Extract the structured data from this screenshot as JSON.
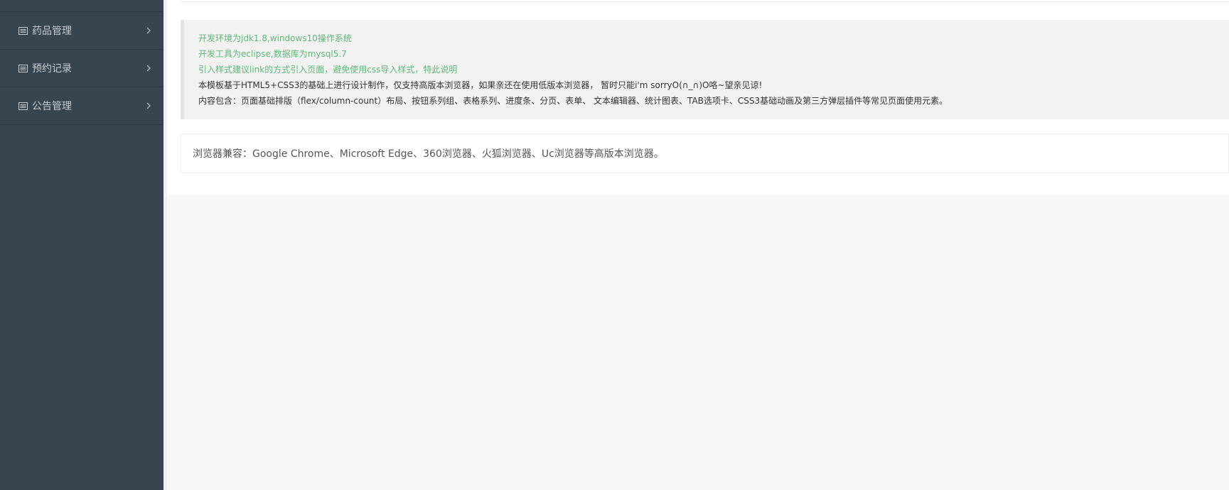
{
  "sidebar": {
    "items": [
      {
        "label": "药品管理",
        "icon": "list-icon"
      },
      {
        "label": "预约记录",
        "icon": "list-icon"
      },
      {
        "label": "公告管理",
        "icon": "list-icon"
      }
    ]
  },
  "notice": {
    "lines": [
      "开发环境为jdk1.8,windows10操作系统",
      "开发工具为eclipse,数据库为mysql5.7",
      "引入样式建议link的方式引入页面，避免使用css导入样式，特此说明",
      "本模板基于HTML5+CSS3的基础上进行设计制作，仅支持高版本浏览器，如果亲还在使用低版本浏览器， 暂时只能i'm sorryO(∩_∩)O咯~望亲见谅!",
      "内容包含：页面基础排版（flex/column-count）布局、按钮系列组、表格系列、进度条、分页、表单、 文本编辑器、统计图表、TAB选项卡、CSS3基础动画及第三方弹层插件等常见页面使用元素。"
    ]
  },
  "browser_compat": {
    "text": "浏览器兼容：Google Chrome、Microsoft Edge、360浏览器、火狐浏览器、Uc浏览器等高版本浏览器。"
  },
  "colors": {
    "sidebar_bg": "#374551",
    "green_text": "#5fb878",
    "dark_text": "#333333"
  }
}
